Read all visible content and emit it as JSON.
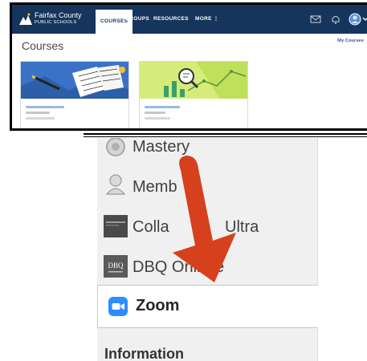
{
  "top_screenshot": {
    "logo": {
      "line1": "Fairfax County",
      "line2": "PUBLIC SCHOOLS"
    },
    "nav_tabs": [
      {
        "label": "COURSES",
        "active": true
      },
      {
        "label": "GROUPS",
        "active": false
      },
      {
        "label": "RESOURCES",
        "active": false
      },
      {
        "label": "MORE ⋮",
        "active": false
      }
    ],
    "nav_icons": [
      "mail-icon",
      "bell-icon",
      "avatar",
      "chevron-down-icon"
    ],
    "section_title": "Courses",
    "my_courses_link": "My Courses",
    "cards": [
      {
        "image": "notebook-pencil-illustration",
        "text_blurred": true
      },
      {
        "image": "chart-magnifier-illustration",
        "text_blurred": true
      }
    ]
  },
  "bottom_screenshot": {
    "menu_items": [
      {
        "label": "Mastery",
        "icon": "mastery-icon"
      },
      {
        "label": "Memb",
        "icon": "member-icon"
      },
      {
        "label": "Colla",
        "label_suffix": "Ultra",
        "icon": "blackboard-collaborate-icon"
      },
      {
        "label": "DBQ Onli",
        "label_suffix": "e",
        "icon": "dbq-icon",
        "icon_text": "DBQ"
      }
    ],
    "highlighted_item": {
      "label": "Zoom",
      "icon": "zoom-video-icon"
    },
    "section_heading": "Information"
  },
  "colors": {
    "nav_bg": "#16355d",
    "arrow": "#d6401d",
    "zoom_blue": "#2d8cff"
  }
}
